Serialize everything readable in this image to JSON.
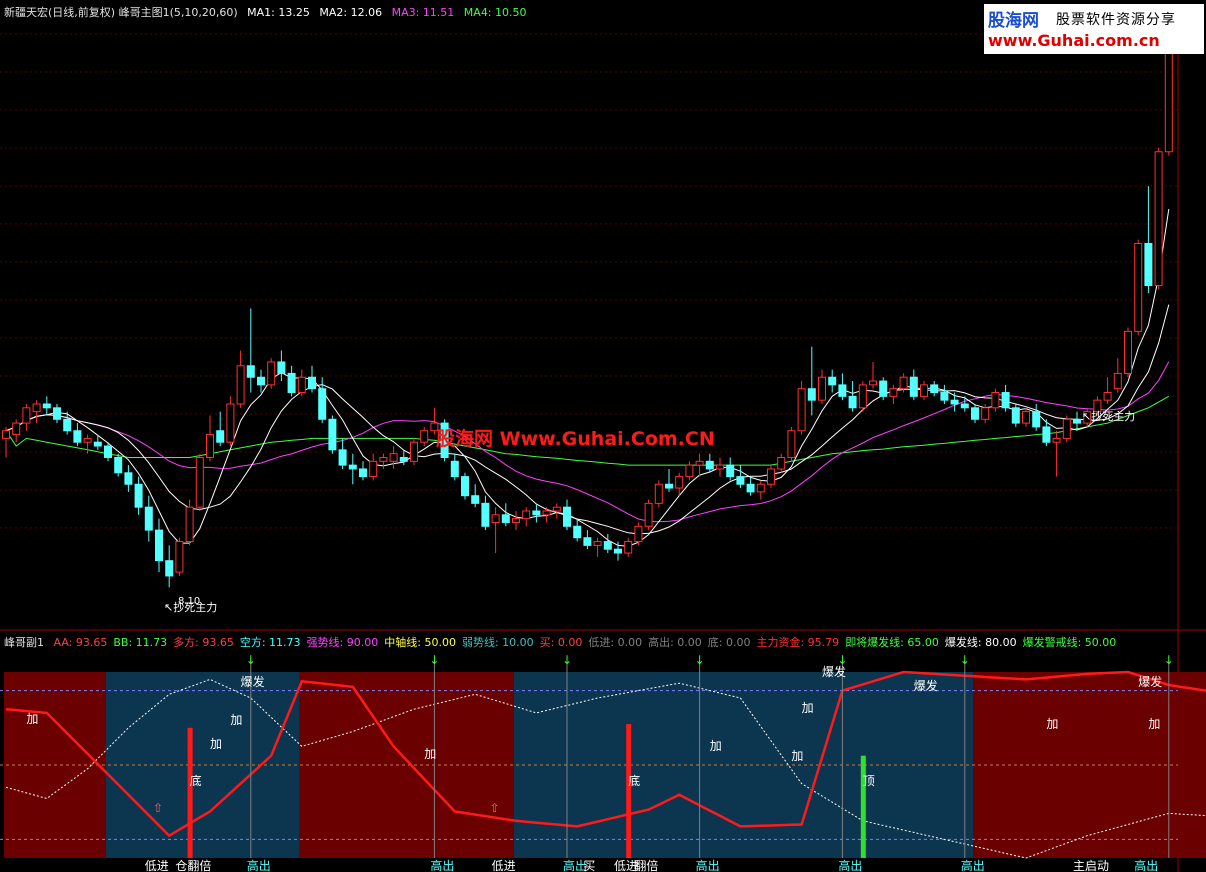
{
  "main_header": {
    "title": "新疆天宏(日线,前复权) 峰哥主图1(5,10,20,60)",
    "ma1": "MA1: 13.25",
    "ma2": "MA2: 12.06",
    "ma3": "MA3: 11.51",
    "ma4": "MA4: 10.50"
  },
  "sub_header": {
    "title": "峰哥副1",
    "items": [
      {
        "text": "AA: 93.65",
        "color": "#ff4040"
      },
      {
        "text": "BB: 11.73",
        "color": "#40ff40"
      },
      {
        "text": "多方: 93.65",
        "color": "#ff4040"
      },
      {
        "text": "空方: 11.73",
        "color": "#40ffff"
      },
      {
        "text": "强势线: 90.00",
        "color": "#ff40ff"
      },
      {
        "text": "中轴线: 50.00",
        "color": "#ffff40"
      },
      {
        "text": "弱势线: 10.00",
        "color": "#40c0c0"
      },
      {
        "text": "买: 0.00",
        "color": "#ff4040"
      },
      {
        "text": "低进: 0.00",
        "color": "#808080"
      },
      {
        "text": "高出: 0.00",
        "color": "#808080"
      },
      {
        "text": "底: 0.00",
        "color": "#808080"
      },
      {
        "text": "主力资金: 95.79",
        "color": "#ff3030"
      },
      {
        "text": "即将爆发线: 65.00",
        "color": "#40ff40"
      },
      {
        "text": "爆发线: 80.00",
        "color": "#ffffff"
      },
      {
        "text": "爆发警戒线: 50.00",
        "color": "#40ff40"
      }
    ]
  },
  "logo": {
    "brand": "股海网",
    "slogan": "股票软件资源分享",
    "url": "www.Guhai.com.cn"
  },
  "watermark": "股海网 Www.Guhai.Com.CN",
  "annotations": {
    "low1_price": "8.10",
    "main_label": "抄死主力"
  },
  "colors": {
    "up_candle": "#ff3030",
    "down_candle": "#54ffff",
    "ma1": "#ffffff",
    "ma2": "#ffffff",
    "ma3": "#ff40ff",
    "ma4": "#40ff40",
    "bull_zone": "#6b0000",
    "bear_zone": "#0c3550",
    "fund_line": "#ff1a1a",
    "bb_line": "#ffffff"
  },
  "chart_data": {
    "type": "candlestick",
    "candles": [
      [
        12.0,
        12.3,
        11.5,
        12.2
      ],
      [
        12.1,
        12.5,
        11.9,
        12.4
      ],
      [
        12.4,
        12.9,
        12.2,
        12.8
      ],
      [
        12.7,
        13.0,
        12.4,
        12.9
      ],
      [
        12.9,
        13.1,
        12.6,
        12.8
      ],
      [
        12.8,
        12.9,
        12.4,
        12.5
      ],
      [
        12.5,
        12.7,
        12.1,
        12.2
      ],
      [
        12.2,
        12.4,
        11.8,
        11.9
      ],
      [
        11.9,
        12.1,
        11.6,
        12.0
      ],
      [
        11.9,
        12.1,
        11.7,
        11.8
      ],
      [
        11.8,
        11.9,
        11.4,
        11.5
      ],
      [
        11.5,
        11.6,
        11.0,
        11.1
      ],
      [
        11.1,
        11.3,
        10.6,
        10.8
      ],
      [
        10.8,
        11.0,
        10.0,
        10.2
      ],
      [
        10.2,
        10.5,
        9.3,
        9.6
      ],
      [
        9.6,
        9.9,
        8.5,
        8.8
      ],
      [
        8.8,
        9.2,
        8.1,
        8.4
      ],
      [
        8.5,
        9.4,
        8.4,
        9.3
      ],
      [
        9.3,
        10.4,
        9.2,
        10.2
      ],
      [
        10.2,
        11.6,
        10.1,
        11.5
      ],
      [
        11.5,
        12.6,
        11.4,
        12.1
      ],
      [
        12.2,
        12.7,
        11.8,
        11.9
      ],
      [
        11.9,
        13.1,
        11.8,
        12.9
      ],
      [
        12.9,
        14.3,
        12.8,
        13.9
      ],
      [
        13.9,
        15.4,
        13.2,
        13.6
      ],
      [
        13.6,
        13.8,
        13.2,
        13.4
      ],
      [
        13.4,
        14.1,
        13.3,
        14.0
      ],
      [
        14.0,
        14.3,
        13.5,
        13.7
      ],
      [
        13.7,
        13.9,
        13.1,
        13.2
      ],
      [
        13.2,
        13.8,
        13.1,
        13.6
      ],
      [
        13.6,
        13.9,
        13.2,
        13.3
      ],
      [
        13.3,
        13.6,
        12.4,
        12.5
      ],
      [
        12.5,
        12.6,
        11.6,
        11.7
      ],
      [
        11.7,
        12.0,
        11.2,
        11.3
      ],
      [
        11.3,
        11.6,
        10.8,
        11.2
      ],
      [
        11.2,
        11.4,
        10.9,
        11.0
      ],
      [
        11.0,
        11.6,
        10.9,
        11.4
      ],
      [
        11.4,
        11.6,
        11.2,
        11.5
      ],
      [
        11.4,
        11.8,
        11.2,
        11.6
      ],
      [
        11.5,
        11.7,
        11.3,
        11.4
      ],
      [
        11.4,
        12.0,
        11.3,
        11.9
      ],
      [
        11.9,
        12.3,
        11.8,
        12.2
      ],
      [
        12.2,
        12.8,
        12.1,
        12.4
      ],
      [
        12.4,
        12.5,
        11.4,
        11.5
      ],
      [
        11.4,
        11.6,
        10.9,
        11.0
      ],
      [
        11.0,
        11.1,
        10.4,
        10.5
      ],
      [
        10.5,
        10.8,
        10.2,
        10.3
      ],
      [
        10.3,
        10.5,
        9.6,
        9.7
      ],
      [
        9.8,
        10.2,
        9.0,
        10.0
      ],
      [
        10.0,
        10.3,
        9.7,
        9.8
      ],
      [
        9.8,
        10.1,
        9.6,
        9.9
      ],
      [
        9.9,
        10.2,
        9.7,
        10.1
      ],
      [
        10.1,
        10.3,
        9.8,
        10.0
      ],
      [
        10.0,
        10.2,
        9.8,
        10.1
      ],
      [
        10.1,
        10.3,
        9.9,
        10.2
      ],
      [
        10.2,
        10.4,
        9.6,
        9.7
      ],
      [
        9.7,
        9.9,
        9.3,
        9.4
      ],
      [
        9.4,
        9.6,
        9.1,
        9.2
      ],
      [
        9.2,
        9.4,
        8.9,
        9.3
      ],
      [
        9.3,
        9.5,
        9.0,
        9.1
      ],
      [
        9.1,
        9.3,
        8.8,
        9.0
      ],
      [
        9.0,
        9.4,
        8.9,
        9.3
      ],
      [
        9.3,
        9.8,
        9.2,
        9.7
      ],
      [
        9.7,
        10.4,
        9.6,
        10.3
      ],
      [
        10.3,
        10.9,
        10.2,
        10.8
      ],
      [
        10.8,
        11.2,
        10.6,
        10.7
      ],
      [
        10.7,
        11.1,
        10.5,
        11.0
      ],
      [
        11.0,
        11.4,
        10.9,
        11.3
      ],
      [
        11.3,
        11.6,
        11.0,
        11.4
      ],
      [
        11.4,
        11.6,
        11.1,
        11.2
      ],
      [
        11.2,
        11.5,
        11.0,
        11.3
      ],
      [
        11.3,
        11.5,
        10.9,
        11.0
      ],
      [
        11.0,
        11.3,
        10.7,
        10.8
      ],
      [
        10.8,
        11.0,
        10.5,
        10.6
      ],
      [
        10.6,
        10.9,
        10.4,
        10.8
      ],
      [
        10.8,
        11.3,
        10.7,
        11.2
      ],
      [
        11.2,
        11.6,
        11.1,
        11.5
      ],
      [
        11.5,
        12.3,
        11.4,
        12.2
      ],
      [
        12.2,
        13.5,
        12.1,
        13.3
      ],
      [
        13.3,
        14.4,
        12.6,
        13.0
      ],
      [
        13.0,
        13.8,
        12.9,
        13.6
      ],
      [
        13.6,
        13.8,
        13.2,
        13.4
      ],
      [
        13.4,
        13.7,
        13.0,
        13.1
      ],
      [
        13.1,
        13.5,
        12.7,
        12.8
      ],
      [
        12.8,
        13.5,
        12.7,
        13.4
      ],
      [
        13.4,
        14.0,
        13.3,
        13.5
      ],
      [
        13.5,
        13.6,
        13.0,
        13.1
      ],
      [
        13.1,
        13.4,
        12.9,
        13.3
      ],
      [
        13.3,
        13.7,
        13.2,
        13.6
      ],
      [
        13.6,
        13.8,
        13.0,
        13.1
      ],
      [
        13.1,
        13.5,
        13.0,
        13.4
      ],
      [
        13.4,
        13.5,
        13.1,
        13.2
      ],
      [
        13.2,
        13.4,
        12.9,
        13.0
      ],
      [
        13.0,
        13.2,
        12.7,
        12.9
      ],
      [
        12.9,
        13.1,
        12.7,
        12.8
      ],
      [
        12.8,
        12.9,
        12.4,
        12.5
      ],
      [
        12.5,
        12.9,
        12.4,
        12.8
      ],
      [
        12.8,
        13.3,
        12.7,
        13.2
      ],
      [
        13.2,
        13.4,
        12.7,
        12.8
      ],
      [
        12.8,
        12.9,
        12.3,
        12.4
      ],
      [
        12.4,
        12.8,
        12.3,
        12.7
      ],
      [
        12.7,
        12.9,
        12.2,
        12.3
      ],
      [
        12.3,
        12.5,
        11.8,
        11.9
      ],
      [
        11.9,
        12.2,
        11.0,
        12.0
      ],
      [
        12.0,
        12.6,
        11.9,
        12.5
      ],
      [
        12.5,
        12.7,
        12.2,
        12.4
      ],
      [
        12.4,
        12.8,
        12.3,
        12.7
      ],
      [
        12.7,
        13.1,
        12.6,
        13.0
      ],
      [
        13.0,
        13.6,
        12.9,
        13.2
      ],
      [
        13.3,
        14.1,
        13.2,
        13.7
      ],
      [
        13.7,
        14.9,
        13.6,
        14.8
      ],
      [
        14.8,
        17.2,
        14.7,
        17.1
      ],
      [
        17.1,
        18.6,
        15.8,
        16.0
      ],
      [
        16.0,
        19.6,
        15.9,
        19.5
      ],
      [
        19.5,
        22.7,
        19.4,
        22.6
      ]
    ],
    "ylim": [
      7.3,
      23.0
    ],
    "ma4": [
      12.2,
      11.8,
      12.0,
      11.95,
      11.9,
      11.85,
      11.8,
      11.75,
      11.7,
      11.65,
      11.6,
      11.55,
      11.5,
      11.5,
      11.5,
      11.5,
      11.5,
      11.5,
      11.5,
      11.55,
      11.6,
      11.65,
      11.7,
      11.75,
      11.8,
      11.85,
      11.9,
      11.92,
      11.95,
      11.97,
      12.0,
      12.0,
      12.0,
      12.0,
      12.0,
      12.0,
      12.0,
      12.0,
      12.0,
      12.0,
      12.0,
      11.97,
      11.95,
      11.9,
      11.85,
      11.8,
      11.75,
      11.7,
      11.65,
      11.6,
      11.58,
      11.55,
      11.52,
      11.5,
      11.48,
      11.45,
      11.42,
      11.4,
      11.38,
      11.35,
      11.33,
      11.3,
      11.3,
      11.3,
      11.3,
      11.3,
      11.3,
      11.3,
      11.3,
      11.3,
      11.3,
      11.3,
      11.3,
      11.3,
      11.3,
      11.3,
      11.35,
      11.4,
      11.45,
      11.5,
      11.55,
      11.6,
      11.62,
      11.65,
      11.68,
      11.7,
      11.72,
      11.75,
      11.78,
      11.8,
      11.82,
      11.85,
      11.87,
      11.9,
      11.92,
      11.95,
      11.97,
      12.0,
      12.02,
      12.05,
      12.07,
      12.1,
      12.12,
      12.15,
      12.2,
      12.25,
      12.3,
      12.35,
      12.4,
      12.5,
      12.6,
      12.7,
      12.8,
      12.95,
      13.1
    ]
  },
  "sub_chart": {
    "type": "oscillator",
    "ylim": [
      0,
      100
    ],
    "levels": [
      90,
      50,
      10
    ],
    "zones": [
      {
        "from": 0,
        "to": 10,
        "kind": "bull"
      },
      {
        "from": 10,
        "to": 29,
        "kind": "bear"
      },
      {
        "from": 29,
        "to": 50,
        "kind": "bull"
      },
      {
        "from": 50,
        "to": 95,
        "kind": "bear"
      },
      {
        "from": 95,
        "to": 147,
        "kind": "bull"
      },
      {
        "from": 147,
        "to": 158,
        "kind": "bear"
      },
      {
        "from": 158,
        "to": 170,
        "kind": "bull"
      }
    ],
    "labels_top": [
      "加",
      "加",
      "加",
      "爆发",
      "加",
      "加",
      "加",
      "加",
      "爆发",
      "爆发",
      "加",
      "加",
      "爆发"
    ],
    "labels_bottom": [
      "低进",
      "仓翻倍",
      "高出",
      "高出",
      "低进",
      "高出",
      "买",
      "低进",
      "翻倍",
      "高出",
      "高出",
      "高出",
      "主启动",
      "高出"
    ],
    "labels_mid": [
      "底",
      "底",
      "顶"
    ]
  }
}
